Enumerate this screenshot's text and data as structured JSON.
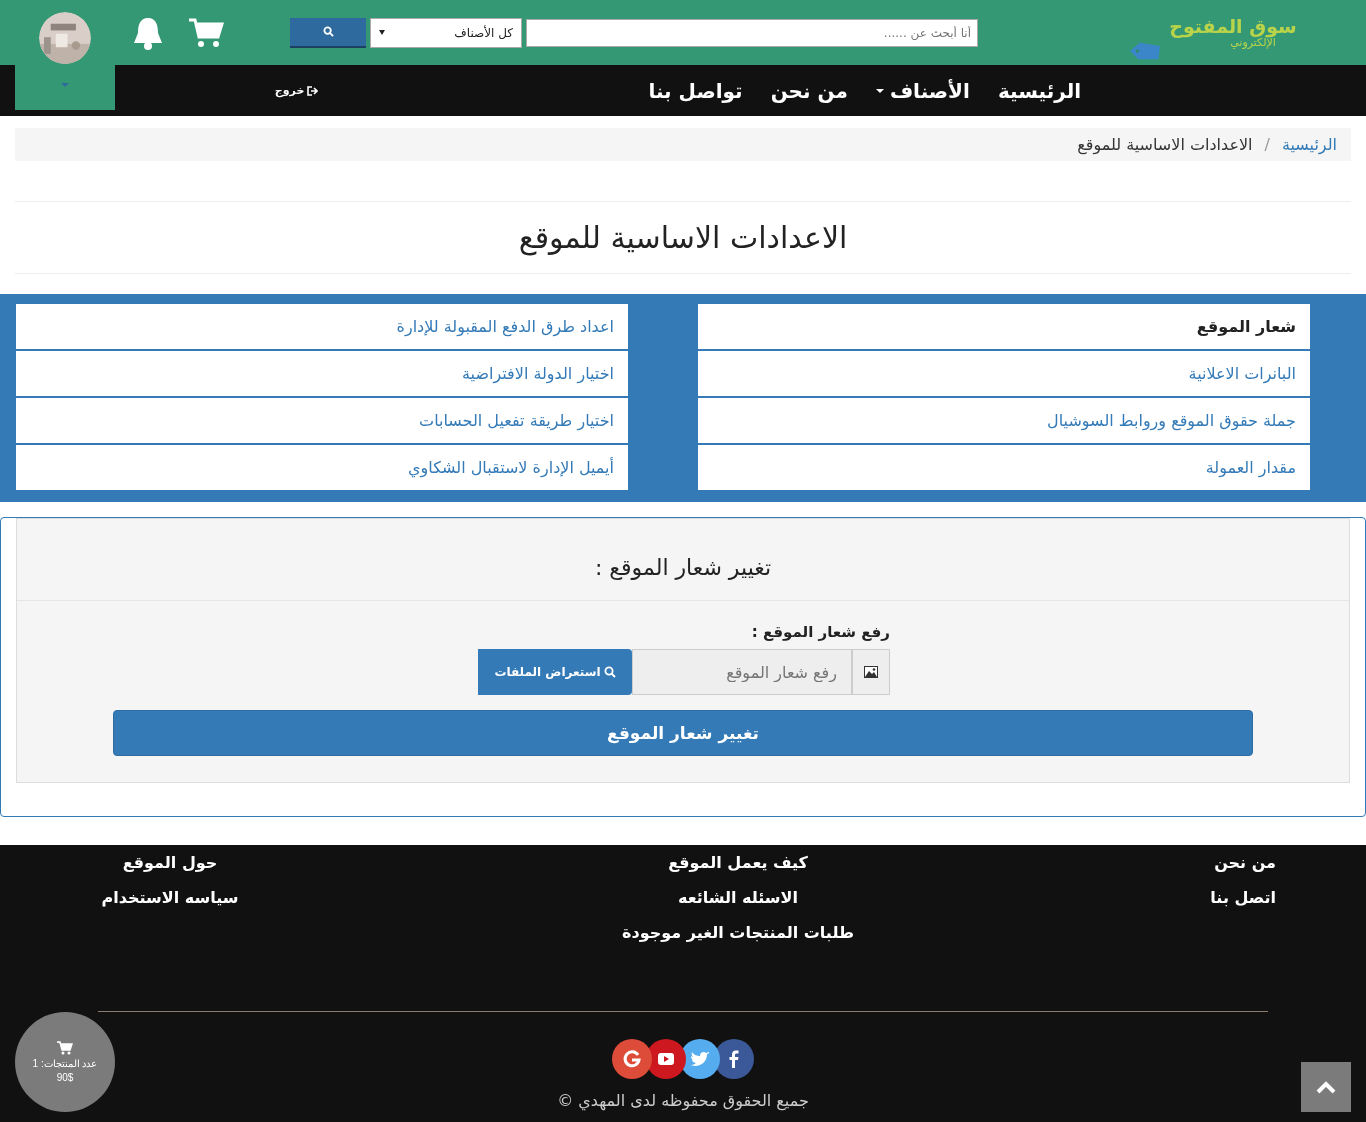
{
  "logo": {
    "line_1": "سوق المفتوح",
    "line_2": "الإلكتروني"
  },
  "search": {
    "placeholder": "أنا أبحث عن ......",
    "category": "كل الأصناف"
  },
  "nav": [
    {
      "label": "الرئيسية",
      "dropdown": false
    },
    {
      "label": "الأصناف",
      "dropdown": true
    },
    {
      "label": "من نحن",
      "dropdown": false
    },
    {
      "label": "تواصل بنا",
      "dropdown": false
    }
  ],
  "logout": "خروج",
  "breadcrumb_separator": "/",
  "breadcrumb": [
    {
      "label": "الرئيسية",
      "link": true
    },
    {
      "label": "الاعدادات الاساسية للموقع",
      "link": false
    }
  ],
  "page_title": "الاعدادات الاساسية للموقع",
  "settings_menu": [
    [
      {
        "label": "شعار الموقع",
        "selected": true
      },
      {
        "label": "البانرات الاعلانية",
        "selected": false
      },
      {
        "label": "جملة حقوق الموقع وروابط السوشيال",
        "selected": false
      },
      {
        "label": "مقدار العمولة",
        "selected": false
      }
    ],
    [
      {
        "label": "اعداد طرق الدفع المقبولة للإدارة",
        "selected": false
      },
      {
        "label": "اختيار الدولة الافتراضية",
        "selected": false
      },
      {
        "label": "اختيار طريقة تفعيل الحسابات",
        "selected": false
      },
      {
        "label": "أيميل الإدارة لاستقبال الشكاوي",
        "selected": false
      }
    ]
  ],
  "panel": {
    "title": "تغيير شعار الموقع :",
    "field_label": "رفع شعار الموقع :",
    "field_placeholder": "رفع شعار الموقع",
    "browse_button": "استعراض الملفات",
    "submit_button": "تغيير شعار الموقع"
  },
  "footer_columns": [
    [
      "من نحن",
      "اتصل بنا"
    ],
    [
      "كيف يعمل الموقع",
      "الاسئله الشائعه",
      "طلبات المنتجات الغير موجودة"
    ],
    [
      "حول الموقع",
      "سياسه الاستخدام"
    ]
  ],
  "social": [
    {
      "kind": "facebook",
      "color": "#3b5998"
    },
    {
      "kind": "twitter",
      "color": "#55acee"
    },
    {
      "kind": "youtube",
      "color": "#cc181e"
    },
    {
      "kind": "google",
      "color": "#dd4b39"
    }
  ],
  "copyright": "جميع الحقوق محفوظه لدى المهدي ©",
  "cart_bubble": {
    "count_label": "عدد المنتجات: 1",
    "total": "90$"
  }
}
